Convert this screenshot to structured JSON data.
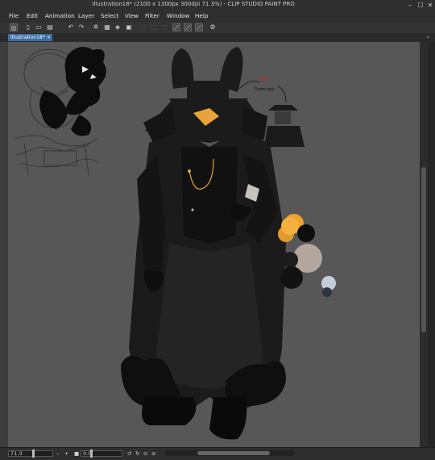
{
  "window": {
    "title": "Illustration18* (2100 x 1300px 300dpi 71.3%) - CLIP STUDIO PAINT PRO",
    "minimize": "–",
    "maximize": "☐",
    "close": "✕"
  },
  "menu": [
    "File",
    "Edit",
    "Animation",
    "Layer",
    "Select",
    "View",
    "Filter",
    "Window",
    "Help"
  ],
  "tab": {
    "label": "Illustration18*",
    "close": "×"
  },
  "status": {
    "zoom": "71.3",
    "angle": "0.0"
  },
  "canvas_annotation": {
    "label": "#07",
    "sub": "Same guy"
  },
  "colors": {
    "accent": "#3c6fa6",
    "canvas_bg": "#585757",
    "gold": "#e8a43a",
    "orange": "#f2a12e",
    "beige": "#b3a69d",
    "light_blue": "#c5cfdb",
    "dark_gray": "#2f3540"
  },
  "icons": [
    "app-icon",
    "new-file-icon",
    "open-file-icon",
    "save-icon",
    "undo-icon",
    "redo-icon",
    "ruler-icon",
    "clear-icon",
    "fill-icon",
    "transform-icon",
    "pen-stabilizer-icon",
    "settings-icon"
  ]
}
